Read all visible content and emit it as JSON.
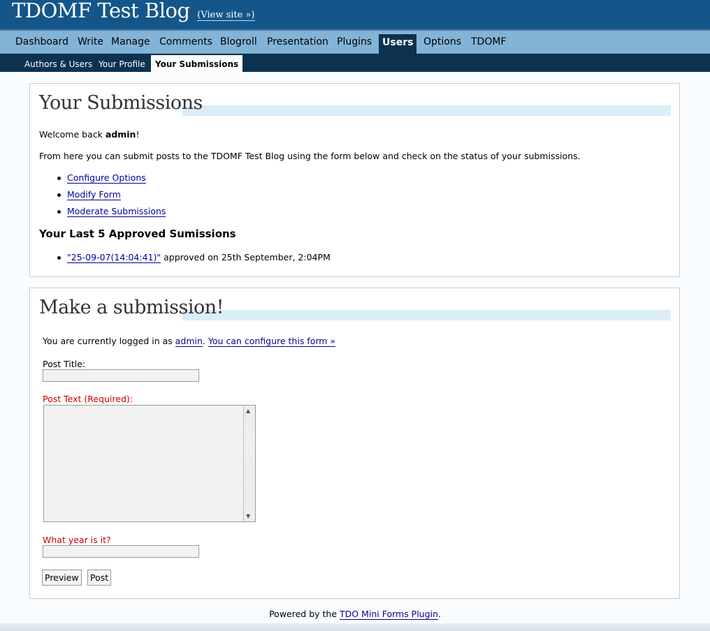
{
  "header": {
    "blog_title": "TDOMF Test Blog",
    "view_site": "(View site »)"
  },
  "adminmenu": {
    "items": [
      "Dashboard",
      "Write",
      "Manage",
      "Comments",
      "Blogroll",
      "Presentation",
      "Plugins",
      "Users",
      "Options",
      "TDOMF"
    ],
    "current": "Users"
  },
  "submenu": {
    "items": [
      "Authors & Users",
      "Your Profile",
      "Your Submissions"
    ],
    "current": "Your Submissions"
  },
  "your_submissions": {
    "heading": "Your Submissions",
    "welcome_prefix": "Welcome back ",
    "username": "admin",
    "welcome_suffix": "!",
    "intro": "From here you can submit posts to the TDOMF Test Blog using the form below and check on the status of your submissions.",
    "links": [
      "Configure Options",
      "Modify Form",
      "Moderate Submissions"
    ],
    "approved_heading": "Your Last 5 Approved Sumissions",
    "approved_items": [
      {
        "title": "\"25-09-07(14:04:41)\"",
        "status": " approved on 25th September, 2:04PM"
      }
    ]
  },
  "make_submission": {
    "heading": "Make a submission!",
    "logged_in_prefix": "You are currently logged in as ",
    "username": "admin",
    "configure_link": "You can configure this form »",
    "post_title_label": "Post Title:",
    "post_title_value": "",
    "post_text_label": "Post Text (Required):",
    "post_text_value": "",
    "year_label": "What year is it?",
    "year_value": "",
    "preview_button": "Preview",
    "post_button": "Post"
  },
  "footer": {
    "prefix": "Powered by the ",
    "link": "TDO Mini Forms Plugin",
    "suffix": "."
  }
}
